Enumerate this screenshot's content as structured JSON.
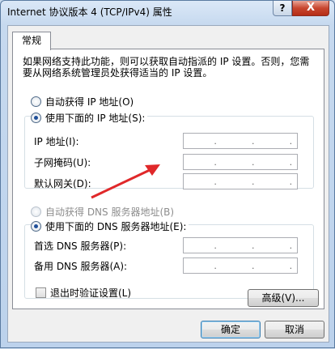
{
  "window": {
    "title": "Internet 协议版本 4 (TCP/IPv4) 属性",
    "help_glyph": "?",
    "close_glyph": "X"
  },
  "tab": {
    "label": "常规"
  },
  "description": "如果网络支持此功能，则可以获取自动指派的 IP 设置。否则，您需要从网络系统管理员处获得适当的 IP 设置。",
  "ip_section": {
    "auto_label": "自动获得 IP 地址(O)",
    "manual_label": "使用下面的 IP 地址(S):",
    "selected": "manual",
    "fields": [
      {
        "label": "IP 地址(I):",
        "value": ". . ."
      },
      {
        "label": "子网掩码(U):",
        "value": ". . ."
      },
      {
        "label": "默认网关(D):",
        "value": ". . ."
      }
    ]
  },
  "dns_section": {
    "auto_label": "自动获得 DNS 服务器地址(B)",
    "manual_label": "使用下面的 DNS 服务器地址(E):",
    "selected": "manual",
    "fields": [
      {
        "label": "首选 DNS 服务器(P):",
        "value": ". . ."
      },
      {
        "label": "备用 DNS 服务器(A):",
        "value": ". . ."
      }
    ]
  },
  "validate_checkbox": {
    "label": "退出时验证设置(L)",
    "checked": false
  },
  "buttons": {
    "advanced": "高级(V)...",
    "ok": "确定",
    "cancel": "取消"
  },
  "annotation": {
    "color": "#e0282a"
  }
}
